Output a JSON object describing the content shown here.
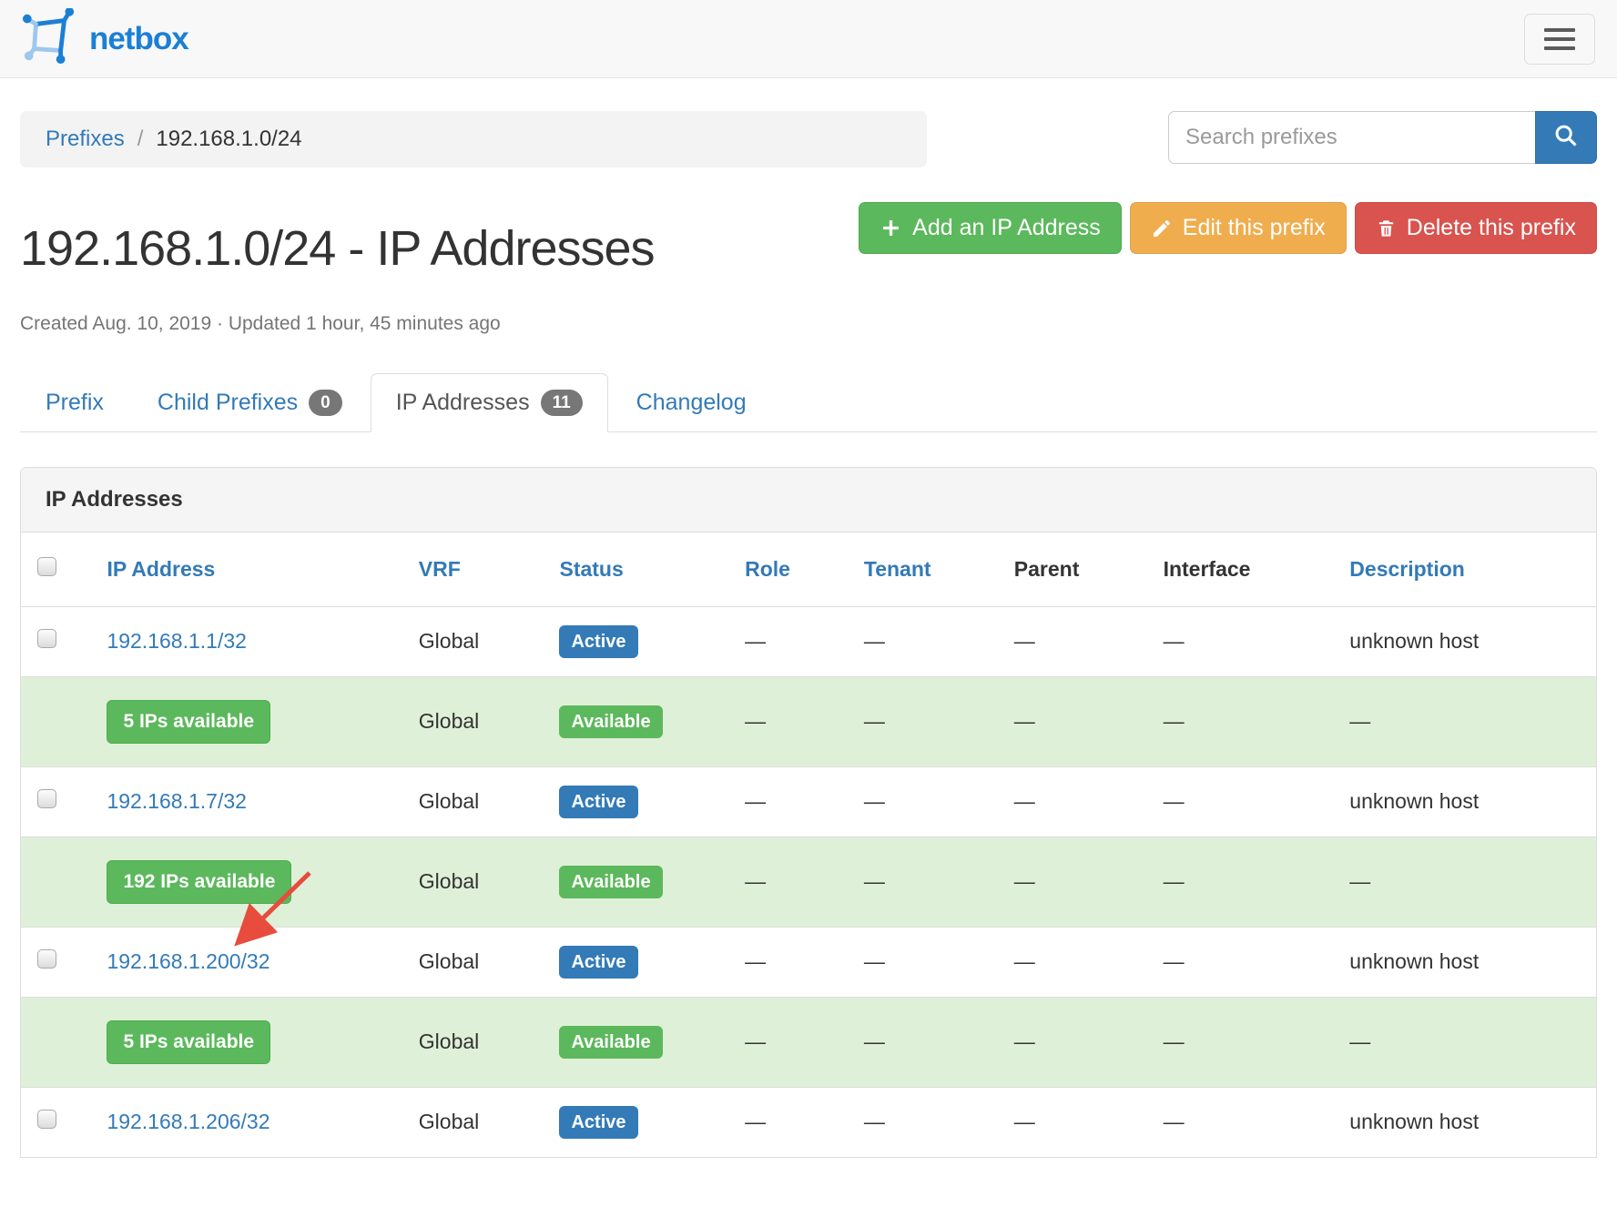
{
  "header": {
    "brand": "netbox"
  },
  "breadcrumb": {
    "link": "Prefixes",
    "separator": "/",
    "current": "192.168.1.0/24"
  },
  "search": {
    "placeholder": "Search prefixes"
  },
  "actions": [
    {
      "id": "add-ip-address-button",
      "label": "Add an IP Address",
      "icon": "plus-icon",
      "color": "#5cb85c"
    },
    {
      "id": "edit-prefix-button",
      "label": "Edit this prefix",
      "icon": "pencil-icon",
      "color": "#f0ad4e"
    },
    {
      "id": "delete-prefix-button",
      "label": "Delete this prefix",
      "icon": "trash-icon",
      "color": "#d9534f"
    }
  ],
  "page": {
    "title": "192.168.1.0/24 - IP Addresses",
    "meta": "Created Aug. 10, 2019 · Updated 1 hour, 45 minutes ago"
  },
  "tabs": [
    {
      "label": "Prefix",
      "badge": null,
      "active": false
    },
    {
      "label": "Child Prefixes",
      "badge": "0",
      "active": false
    },
    {
      "label": "IP Addresses",
      "badge": "11",
      "active": true
    },
    {
      "label": "Changelog",
      "badge": null,
      "active": false
    }
  ],
  "table": {
    "panel_title": "IP Addresses",
    "columns": [
      {
        "label": "IP Address",
        "link": true
      },
      {
        "label": "VRF",
        "link": true
      },
      {
        "label": "Status",
        "link": true
      },
      {
        "label": "Role",
        "link": true
      },
      {
        "label": "Tenant",
        "link": true
      },
      {
        "label": "Parent",
        "link": false
      },
      {
        "label": "Interface",
        "link": false
      },
      {
        "label": "Description",
        "link": true
      }
    ],
    "rows": [
      {
        "type": "ip",
        "ip": "192.168.1.1/32",
        "vrf": "Global",
        "status": "Active",
        "role": "—",
        "tenant": "—",
        "parent": "—",
        "interface": "—",
        "description": "unknown host"
      },
      {
        "type": "available",
        "label": "5 IPs available",
        "vrf": "Global",
        "status": "Available",
        "role": "—",
        "tenant": "—",
        "parent": "—",
        "interface": "—",
        "description": "—"
      },
      {
        "type": "ip",
        "ip": "192.168.1.7/32",
        "vrf": "Global",
        "status": "Active",
        "role": "—",
        "tenant": "—",
        "parent": "—",
        "interface": "—",
        "description": "unknown host"
      },
      {
        "type": "available",
        "label": "192 IPs available",
        "vrf": "Global",
        "status": "Available",
        "role": "—",
        "tenant": "—",
        "parent": "—",
        "interface": "—",
        "description": "—"
      },
      {
        "type": "ip",
        "ip": "192.168.1.200/32",
        "vrf": "Global",
        "status": "Active",
        "role": "—",
        "tenant": "—",
        "parent": "—",
        "interface": "—",
        "description": "unknown host"
      },
      {
        "type": "available",
        "label": "5 IPs available",
        "vrf": "Global",
        "status": "Available",
        "role": "—",
        "tenant": "—",
        "parent": "—",
        "interface": "—",
        "description": "—"
      },
      {
        "type": "ip",
        "ip": "192.168.1.206/32",
        "vrf": "Global",
        "status": "Active",
        "role": "—",
        "tenant": "—",
        "parent": "—",
        "interface": "—",
        "description": "unknown host"
      }
    ]
  },
  "colors": {
    "link_blue": "#337ab7",
    "brand_blue": "#1b7fd6",
    "success_green": "#5cb85c",
    "warning_orange": "#f0ad4e",
    "danger_red": "#d9534f",
    "available_row_bg": "#dff0d8",
    "badge_gray": "#777777",
    "annotation_arrow_red": "#e74c3c"
  }
}
